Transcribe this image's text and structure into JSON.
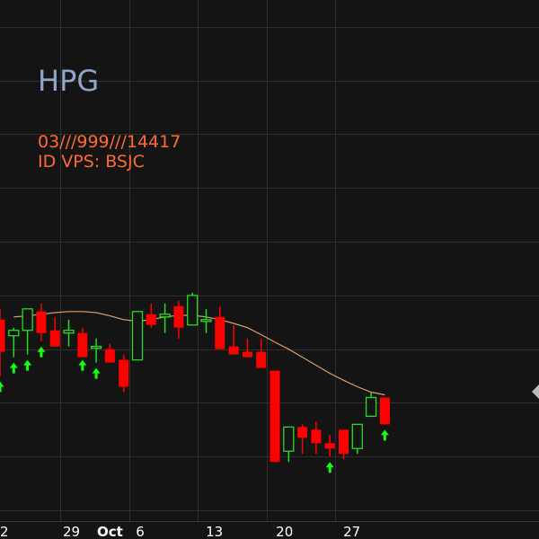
{
  "chart_data": {
    "type": "candlestick",
    "symbol": "HPG",
    "account_line": "03///999///14417",
    "id_line": "ID VPS: BSJC",
    "x_ticks": [
      "22",
      "29",
      "Oct",
      "6",
      "13",
      "20",
      "27"
    ],
    "grid": true,
    "colors": {
      "background": "#141414",
      "grid": "#2e2e2e",
      "up": "#22dd22",
      "down": "#ff0000",
      "ma_line": "#d9a06a",
      "title": "#8fa6c8",
      "info": "#ff6a33",
      "axis_text": "#ffffff",
      "signal_arrow": "#11ff11"
    },
    "candles": [
      {
        "o": 28.55,
        "h": 28.75,
        "l": 27.5,
        "c": 27.95
      },
      {
        "o": 28.25,
        "h": 28.4,
        "l": 27.85,
        "c": 28.35
      },
      {
        "o": 28.35,
        "h": 28.7,
        "l": 27.9,
        "c": 28.75
      },
      {
        "o": 28.7,
        "h": 28.85,
        "l": 28.15,
        "c": 28.3
      },
      {
        "o": 28.35,
        "h": 28.6,
        "l": 28.2,
        "c": 28.05
      },
      {
        "o": 28.3,
        "h": 28.55,
        "l": 28.05,
        "c": 28.35
      },
      {
        "o": 28.3,
        "h": 28.4,
        "l": 27.9,
        "c": 27.85
      },
      {
        "o": 28.05,
        "h": 28.2,
        "l": 27.75,
        "c": 28.05
      },
      {
        "o": 28.0,
        "h": 28.1,
        "l": 27.8,
        "c": 27.75
      },
      {
        "o": 27.8,
        "h": 27.9,
        "l": 27.2,
        "c": 27.3
      },
      {
        "o": 27.8,
        "h": 28.7,
        "l": 27.8,
        "c": 28.7
      },
      {
        "o": 28.65,
        "h": 28.85,
        "l": 28.4,
        "c": 28.45
      },
      {
        "o": 28.6,
        "h": 28.85,
        "l": 28.3,
        "c": 28.65
      },
      {
        "o": 28.8,
        "h": 28.9,
        "l": 28.2,
        "c": 28.4
      },
      {
        "o": 28.45,
        "h": 29.05,
        "l": 28.45,
        "c": 29.0
      },
      {
        "o": 28.55,
        "h": 28.75,
        "l": 28.3,
        "c": 28.55
      },
      {
        "o": 28.6,
        "h": 28.8,
        "l": 28.1,
        "c": 28.0
      },
      {
        "o": 28.05,
        "h": 28.45,
        "l": 27.95,
        "c": 27.9
      },
      {
        "o": 27.95,
        "h": 28.2,
        "l": 27.85,
        "c": 27.85
      },
      {
        "o": 27.95,
        "h": 28.2,
        "l": 27.75,
        "c": 27.65
      },
      {
        "o": 27.6,
        "h": 27.6,
        "l": 25.9,
        "c": 25.9
      },
      {
        "o": 26.1,
        "h": 26.55,
        "l": 25.9,
        "c": 26.55
      },
      {
        "o": 26.55,
        "h": 26.6,
        "l": 26.05,
        "c": 26.35
      },
      {
        "o": 26.5,
        "h": 26.65,
        "l": 26.05,
        "c": 26.25
      },
      {
        "o": 26.25,
        "h": 26.4,
        "l": 26.0,
        "c": 26.15
      },
      {
        "o": 26.5,
        "h": 26.5,
        "l": 25.95,
        "c": 26.05
      },
      {
        "o": 26.15,
        "h": 26.6,
        "l": 26.05,
        "c": 26.6
      },
      {
        "o": 26.75,
        "h": 27.2,
        "l": 26.75,
        "c": 27.1
      },
      {
        "o": 27.1,
        "h": 27.1,
        "l": 26.6,
        "c": 26.6
      }
    ],
    "ma": [
      null,
      28.6,
      28.62,
      28.65,
      28.68,
      28.7,
      28.7,
      28.68,
      28.62,
      28.55,
      28.52,
      28.55,
      28.6,
      28.63,
      28.63,
      28.6,
      28.55,
      28.48,
      28.4,
      28.27,
      28.13,
      28.0,
      27.85,
      27.7,
      27.55,
      27.42,
      27.3,
      27.2,
      27.15
    ],
    "up_arrows_at": [
      0,
      1,
      2,
      3,
      6,
      7,
      24,
      28
    ],
    "ylim": [
      24.8,
      34.5
    ]
  }
}
